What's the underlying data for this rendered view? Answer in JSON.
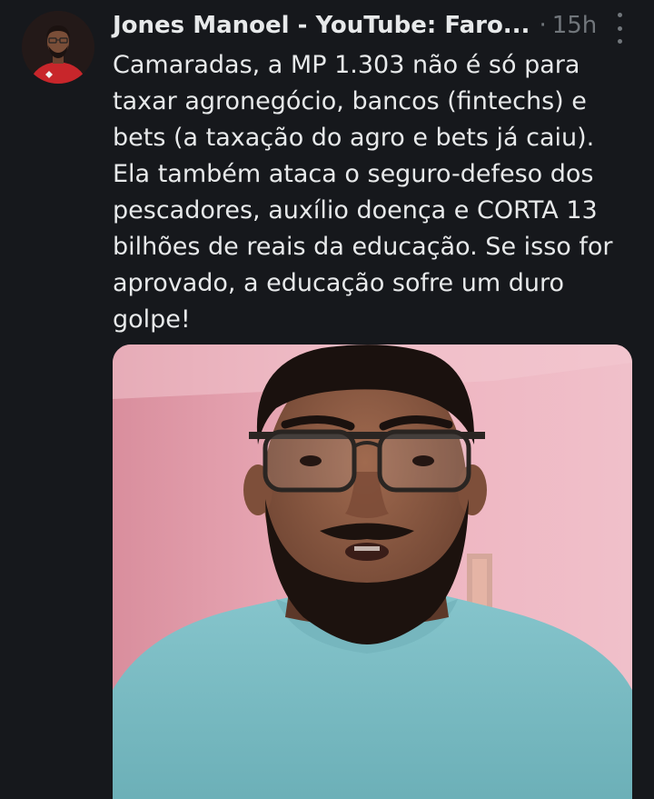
{
  "tweet": {
    "author_name": "Jones Manoel - YouTube: Faro...",
    "separator": "·",
    "timestamp": "15h",
    "text_lines": [
      "Camaradas, a MP 1.303 não é só para",
      "taxar agronegócio, bancos (fintechs) e",
      "bets (a taxação do agro e bets já caiu).",
      "Ela também ataca o seguro-defeso dos",
      "pescadores, auxílio doença e CORTA 13",
      "bilhões de reais da educação. Se isso for",
      "aprovado, a educação sofre um duro",
      "golpe!"
    ]
  },
  "icons": {
    "more": "more-vertical-icon",
    "avatar": "profile-avatar"
  },
  "colors": {
    "background": "#16181c",
    "text_primary": "#e7e9ea",
    "text_secondary": "#71767b",
    "wall_pink": "#e9a8b4",
    "shirt_teal": "#7fbfc6"
  }
}
